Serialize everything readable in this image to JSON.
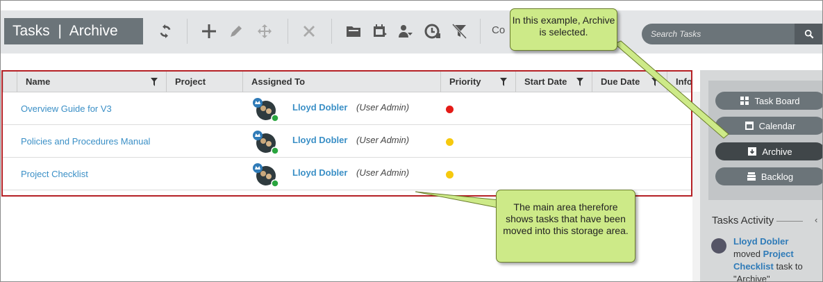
{
  "header": {
    "title": "Tasks",
    "separator": "|",
    "view": "Archive",
    "col_text": "Co",
    "search_placeholder": "Search Tasks"
  },
  "toolbar_icons": [
    "refresh-icon",
    "add-icon",
    "edit-icon",
    "move-icon",
    "delete-icon",
    "folder-icon",
    "calendar-icon",
    "assign-user-icon",
    "clock-icon",
    "clear-filter-icon",
    "search-icon"
  ],
  "table": {
    "columns": [
      "Name",
      "Project",
      "Assigned To",
      "Priority",
      "Start Date",
      "Due Date",
      "Info"
    ],
    "rows": [
      {
        "name": "Overview Guide for V3",
        "project": "",
        "user": "Lloyd Dobler",
        "role": "(User Admin)",
        "priority": "high",
        "priority_color": "#e41b17"
      },
      {
        "name": "Policies and Procedures Manual",
        "project": "",
        "user": "Lloyd Dobler",
        "role": "(User Admin)",
        "priority": "medium",
        "priority_color": "#f6c90e"
      },
      {
        "name": "Project Checklist",
        "project": "",
        "user": "Lloyd Dobler",
        "role": "(User Admin)",
        "priority": "medium",
        "priority_color": "#f6c90e"
      }
    ]
  },
  "sidebar": {
    "buttons": [
      {
        "label": "Task Board",
        "icon": "grid-icon",
        "active": false
      },
      {
        "label": "Calendar",
        "icon": "calendar-icon",
        "active": false
      },
      {
        "label": "Archive",
        "icon": "archive-icon",
        "active": true
      },
      {
        "label": "Backlog",
        "icon": "backlog-icon",
        "active": false
      }
    ],
    "activity_title": "Tasks Activity",
    "activity": {
      "user": "Lloyd Dobler",
      "verb": "moved",
      "task": "Project Checklist",
      "suffix": "task to",
      "target": "\"Archive\""
    }
  },
  "callouts": {
    "top": "In this example, Archive is selected.",
    "bottom": "The main area therefore shows tasks that have been moved into this storage area."
  },
  "colors": {
    "accent_blue": "#3a8fc6",
    "frame_red": "#b52025",
    "callout_green": "#cdea88"
  }
}
